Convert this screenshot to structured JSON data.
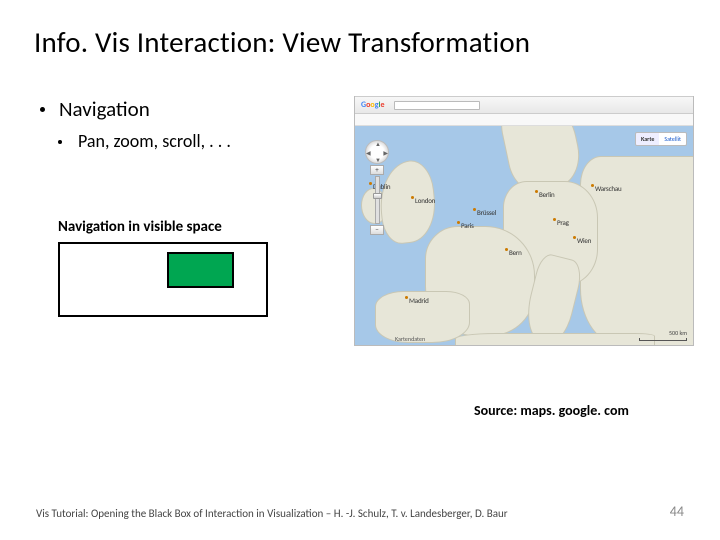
{
  "title": "Info. Vis Interaction: View Transformation",
  "bullets": {
    "l1": "Navigation",
    "l2": "Pan, zoom, scroll, . . ."
  },
  "diagram": {
    "caption": "Navigation in visible space"
  },
  "map": {
    "toggles": {
      "map": "Karte",
      "sat": "Satellit"
    },
    "zoom": {
      "plus": "+",
      "minus": "−"
    },
    "cities": {
      "london": "London",
      "paris": "Paris",
      "berlin": "Berlin",
      "madrid": "Madrid",
      "dublin": "Dublin",
      "warsaw": "Warschau",
      "brussels": "Brüssel",
      "bern": "Bern",
      "vienna": "Wien",
      "prague": "Prag"
    },
    "attribution": "Kartendaten",
    "scale": "500 km"
  },
  "source_label": "Source: maps. google. com",
  "footer": {
    "text": "Vis Tutorial: Opening the Black Box of Interaction in Visualization – H. -J. Schulz, T. v. Landesberger, D. Baur",
    "page": "44"
  }
}
